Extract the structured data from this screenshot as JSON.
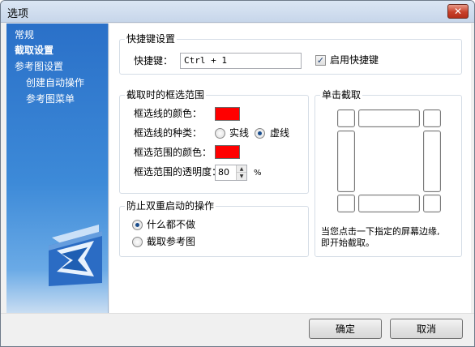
{
  "window": {
    "title": "选项",
    "close_glyph": "✕"
  },
  "sidebar": {
    "items": [
      {
        "label": "常规"
      },
      {
        "label": "截取设置"
      },
      {
        "label": "参考图设置"
      },
      {
        "label": "创建自动操作"
      },
      {
        "label": "参考图菜单"
      }
    ],
    "logo_icon": "app-logo-icon"
  },
  "shortcut": {
    "group_title": "快捷键设置",
    "label": "快捷键：",
    "value": "Ctrl + 1",
    "enable_label": "启用快捷键",
    "enabled": true
  },
  "selection": {
    "group_title": "截取时的框选范围",
    "line_color_label": "框选线的颜色：",
    "line_color": "#ff0000",
    "line_type_label": "框选线的种类：",
    "line_type_options": [
      "实线",
      "虚线"
    ],
    "line_type_selected": "虚线",
    "range_color_label": "框选范围的颜色：",
    "range_color": "#ff0000",
    "opacity_label": "框选范围的透明度：",
    "opacity_value": "80",
    "opacity_unit": "%"
  },
  "prevent": {
    "group_title": "防止双重启动的操作",
    "options": [
      "什么都不做",
      "截取参考图"
    ],
    "selected": "什么都不做"
  },
  "click_capture": {
    "group_title": "单击截取",
    "hint_line1": "当您点击一下指定的屏幕边缘,",
    "hint_line2": "即开始截取。"
  },
  "footer": {
    "ok_label": "确定",
    "cancel_label": "取消"
  }
}
